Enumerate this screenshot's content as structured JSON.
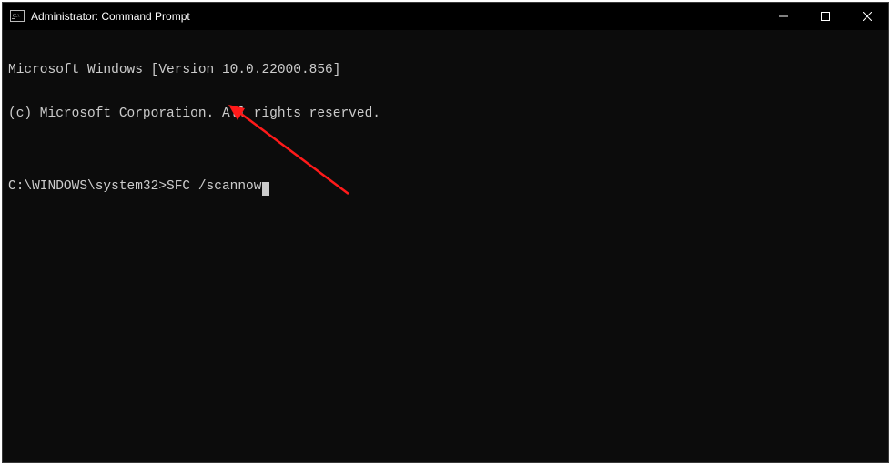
{
  "window": {
    "title": "Administrator: Command Prompt"
  },
  "terminal": {
    "line1": "Microsoft Windows [Version 10.0.22000.856]",
    "line2": "(c) Microsoft Corporation. All rights reserved.",
    "blank": "",
    "prompt": "C:\\WINDOWS\\system32>",
    "command": "SFC /scannow"
  }
}
